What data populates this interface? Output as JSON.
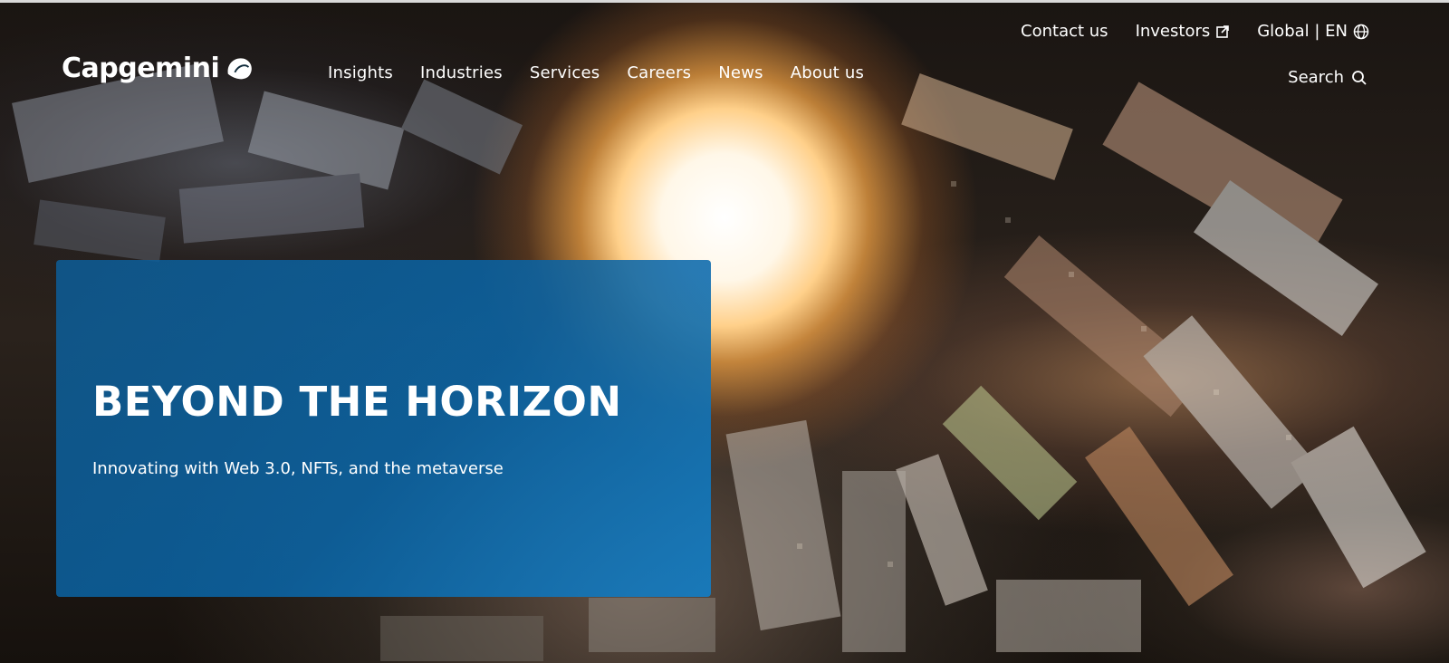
{
  "brand": {
    "name": "Capgemini",
    "icon": "capgemini-spade-logo",
    "colors": {
      "primary": "#0070ad",
      "panel": "#0f66a3",
      "text": "#ffffff"
    }
  },
  "main_nav": [
    {
      "label": "Insights"
    },
    {
      "label": "Industries"
    },
    {
      "label": "Services"
    },
    {
      "label": "Careers"
    },
    {
      "label": "News"
    },
    {
      "label": "About us"
    }
  ],
  "util_nav": {
    "contact": "Contact us",
    "investors": "Investors",
    "investors_icon": "external-link-icon",
    "locale": "Global | EN",
    "locale_icon": "globe-icon"
  },
  "search": {
    "label": "Search",
    "icon": "search-icon"
  },
  "hero": {
    "title": "BEYOND THE HORIZON",
    "subtitle": "Innovating with Web 3.0, NFTs, and the metaverse"
  }
}
